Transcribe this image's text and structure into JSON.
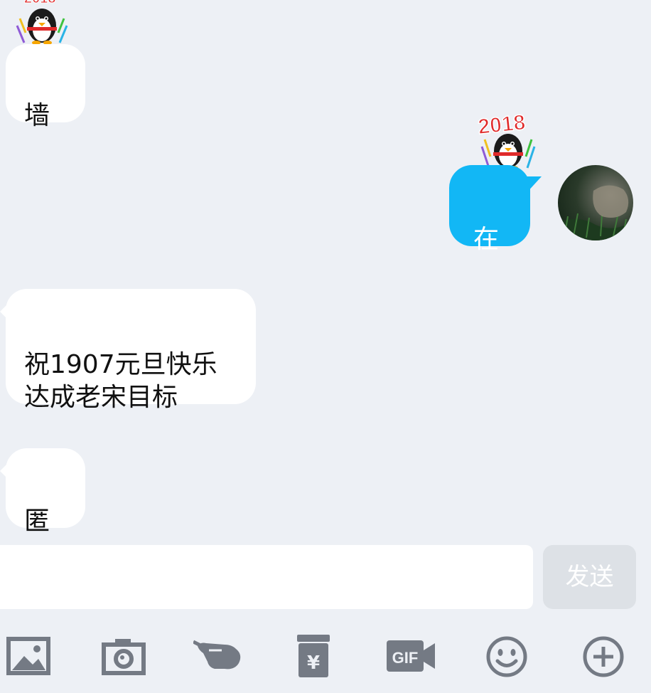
{
  "messages": [
    {
      "id": "msg1",
      "side": "left",
      "text": "墙"
    },
    {
      "id": "msg2",
      "side": "right",
      "text": "在"
    },
    {
      "id": "msg3",
      "side": "left",
      "text": "祝1907元旦快乐\n达成老宋目标"
    },
    {
      "id": "msg4",
      "side": "left",
      "text": "匿"
    }
  ],
  "pendant": {
    "label": "2018"
  },
  "composer": {
    "input_value": "",
    "send_label": "发送"
  },
  "toolbar": [
    {
      "id": "image",
      "icon": "image-icon"
    },
    {
      "id": "camera",
      "icon": "camera-icon"
    },
    {
      "id": "poke",
      "icon": "poke-hand-icon"
    },
    {
      "id": "red_packet",
      "icon": "red-packet-icon",
      "glyph": "¥"
    },
    {
      "id": "gif",
      "icon": "gif-icon",
      "glyph": "GIF"
    },
    {
      "id": "emoji",
      "icon": "emoji-icon"
    },
    {
      "id": "more",
      "icon": "plus-icon"
    }
  ],
  "colors": {
    "background": "#edf0f5",
    "incoming_bubble": "#ffffff",
    "outgoing_bubble": "#12b7f5",
    "toolbar_icon": "#747a84",
    "send_disabled": "#dde1e6"
  }
}
